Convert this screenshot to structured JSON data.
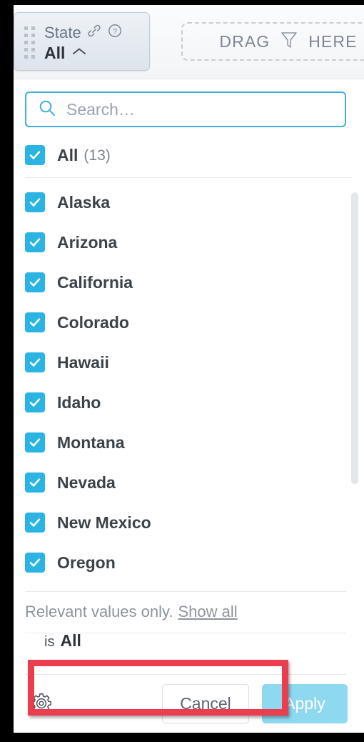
{
  "filter_card": {
    "title": "State",
    "value": "All",
    "link_icon": "link-icon",
    "help_icon": "question-mark-icon",
    "collapse_icon": "chevron-up-icon",
    "drag_handle_icon": "drag-handle-dots-icon"
  },
  "drop_zone": {
    "text_before": "DRAG",
    "text_after": "HERE",
    "icon": "funnel-filter-icon"
  },
  "search": {
    "placeholder": "Search…",
    "value": "",
    "icon": "search-icon"
  },
  "list": {
    "all": {
      "label": "All",
      "count": "(13)",
      "checked": true
    },
    "items": [
      {
        "label": "Alaska",
        "checked": true
      },
      {
        "label": "Arizona",
        "checked": true
      },
      {
        "label": "California",
        "checked": true
      },
      {
        "label": "Colorado",
        "checked": true
      },
      {
        "label": "Hawaii",
        "checked": true
      },
      {
        "label": "Idaho",
        "checked": true
      },
      {
        "label": "Montana",
        "checked": true
      },
      {
        "label": "Nevada",
        "checked": true
      },
      {
        "label": "New Mexico",
        "checked": true
      },
      {
        "label": "Oregon",
        "checked": true
      }
    ]
  },
  "relevant": {
    "text": "Relevant values only.",
    "link": "Show all"
  },
  "condition": {
    "prefix": "is",
    "value": "All"
  },
  "footer": {
    "settings_icon": "gear-icon",
    "cancel_label": "Cancel",
    "apply_label": "Apply"
  },
  "colors": {
    "checkbox_blue": "#29b4e3",
    "search_border_blue": "#3eaedb",
    "apply_blue": "#8ed8f0",
    "annotation_red": "#ea3e4e",
    "text_dark": "#3b4349",
    "text_muted": "#8c949d"
  }
}
